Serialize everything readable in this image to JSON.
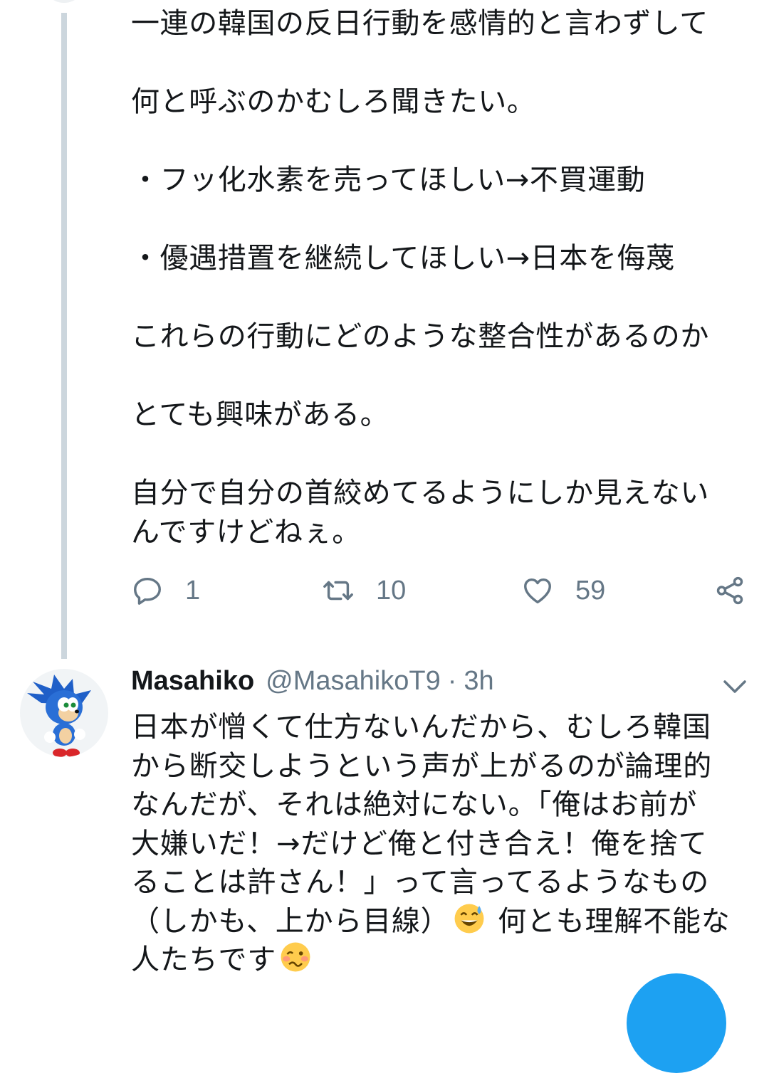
{
  "tweet1": {
    "text": "一連の韓国の反日行動を感情的と言わずして\n\n何と呼ぶのかむしろ聞きたい。\n\n・フッ化水素を売ってほしい→不買運動\n\n・優遇措置を継続してほしい→日本を侮蔑\n\nこれらの行動にどのような整合性があるのか\n\nとても興味がある。\n\n自分で自分の首絞めてるようにしか見えない\nんですけどねぇ。",
    "replies": "1",
    "retweets": "10",
    "likes": "59"
  },
  "tweet2": {
    "display_name": "Masahiko",
    "handle": "@MasahikoT9",
    "separator": "·",
    "time": "3h",
    "text_part1": "日本が憎くて仕方ないんだから、むしろ韓国\nから断交しようという声が上がるのが論理的\nなんだが、それは絶対にない。「俺はお前が\n大嫌いだ！→だけど俺と付き合え！俺を捨て\nることは許さん！」って言ってるようなもの\n（しかも、上から目線）",
    "text_part2": " 何とも理解不能な\n人たちです",
    "emoji1": "sweat-smile-emoji",
    "emoji2": "woozy-face-emoji"
  },
  "colors": {
    "text": "#14171a",
    "muted": "#657786",
    "thread_line": "#ccd6dd",
    "accent": "#1da1f2"
  }
}
